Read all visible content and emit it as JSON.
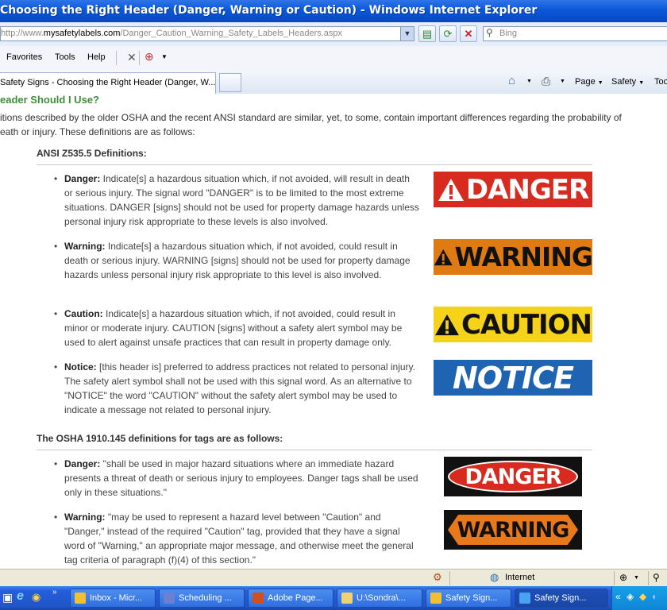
{
  "window": {
    "title": "Choosing the Right Header (Danger, Warning or Caution) - Windows Internet Explorer"
  },
  "address": {
    "url_prefix": "http://www.",
    "url_domain": "mysafetylabels.com",
    "url_path": "/Danger_Caution_Warning_Safety_Labels_Headers.aspx",
    "search_placeholder": "Bing"
  },
  "menu": {
    "items": [
      "Favorites",
      "Tools",
      "Help"
    ]
  },
  "tabs": {
    "active_label": "Safety Signs - Choosing the Right Header (Danger, W...",
    "toolbar": {
      "page": "Page",
      "safety": "Safety",
      "tools": "Too"
    }
  },
  "content": {
    "heading": "eader Should I Use?",
    "intro_line1": "itions described by the older OSHA and the recent ANSI standard are similar, yet, to some, contain important differences regarding the probability of",
    "intro_line2": "eath or injury. These definitions are as follows:",
    "ansi_heading": "ANSI Z535.5 Definitions:",
    "ansi_items": [
      {
        "term": "Danger:",
        "text": " Indicate[s] a hazardous situation which, if not avoided, will result in death or serious injury. The signal word \"DANGER\" is to be limited to the most extreme situations. DANGER [signs] should not be used for property damage hazards unless personal injury risk appropriate to these levels is also involved."
      },
      {
        "term": "Warning:",
        "text": " Indicate[s] a hazardous situation which, if not avoided, could result in death or serious injury. WARNING [signs] should not be used for property damage hazards unless personal injury risk appropriate to this level is also involved."
      },
      {
        "term": "Caution:",
        "text": " Indicate[s] a hazardous situation which, if not avoided, could result in minor or moderate injury. CAUTION [signs] without a safety alert symbol may be used to alert against unsafe practices that can result in property damage only."
      },
      {
        "term": "Notice:",
        "text": " [this header is] preferred to address practices not related to personal injury. The safety alert symbol shall not be used with this signal word. As an alternative to \"NOTICE\" the word \"CAUTION\" without the safety alert symbol may be used to indicate a message not related to personal injury."
      }
    ],
    "ansi_signs": [
      "DANGER",
      "WARNING",
      "CAUTION",
      "NOTICE"
    ],
    "osha_heading": "The OSHA 1910.145 definitions for tags are as follows:",
    "osha_items": [
      {
        "term": "Danger:",
        "text": " \"shall be used in major hazard situations where an immediate hazard presents a threat of death or serious injury to employees. Danger tags shall be used only in these situations.\""
      },
      {
        "term": "Warning:",
        "text": " \"may be used to represent a hazard level between \"Caution\" and \"Danger,\" instead of the required \"Caution\" tag, provided that they have a signal word of \"Warning,\" an appropriate major message, and otherwise meet the general tag criteria of paragraph (f)(4) of this section.\""
      }
    ],
    "osha_signs": [
      "DANGER",
      "WARNING"
    ]
  },
  "status": {
    "zone": "Internet"
  },
  "taskbar": {
    "items": [
      "Inbox - Micr...",
      "Scheduling ...",
      "Adobe Page...",
      "U:\\Sondra\\...",
      "Safety Sign...",
      "Safety Sign..."
    ]
  },
  "colors": {
    "danger_red": "#d72b1f",
    "warning_orange": "#e07a12",
    "caution_yellow": "#f7d21a",
    "notice_blue": "#1f64b2",
    "heading_green": "#3f8d3a",
    "xp_blue": "#0a58d8"
  }
}
